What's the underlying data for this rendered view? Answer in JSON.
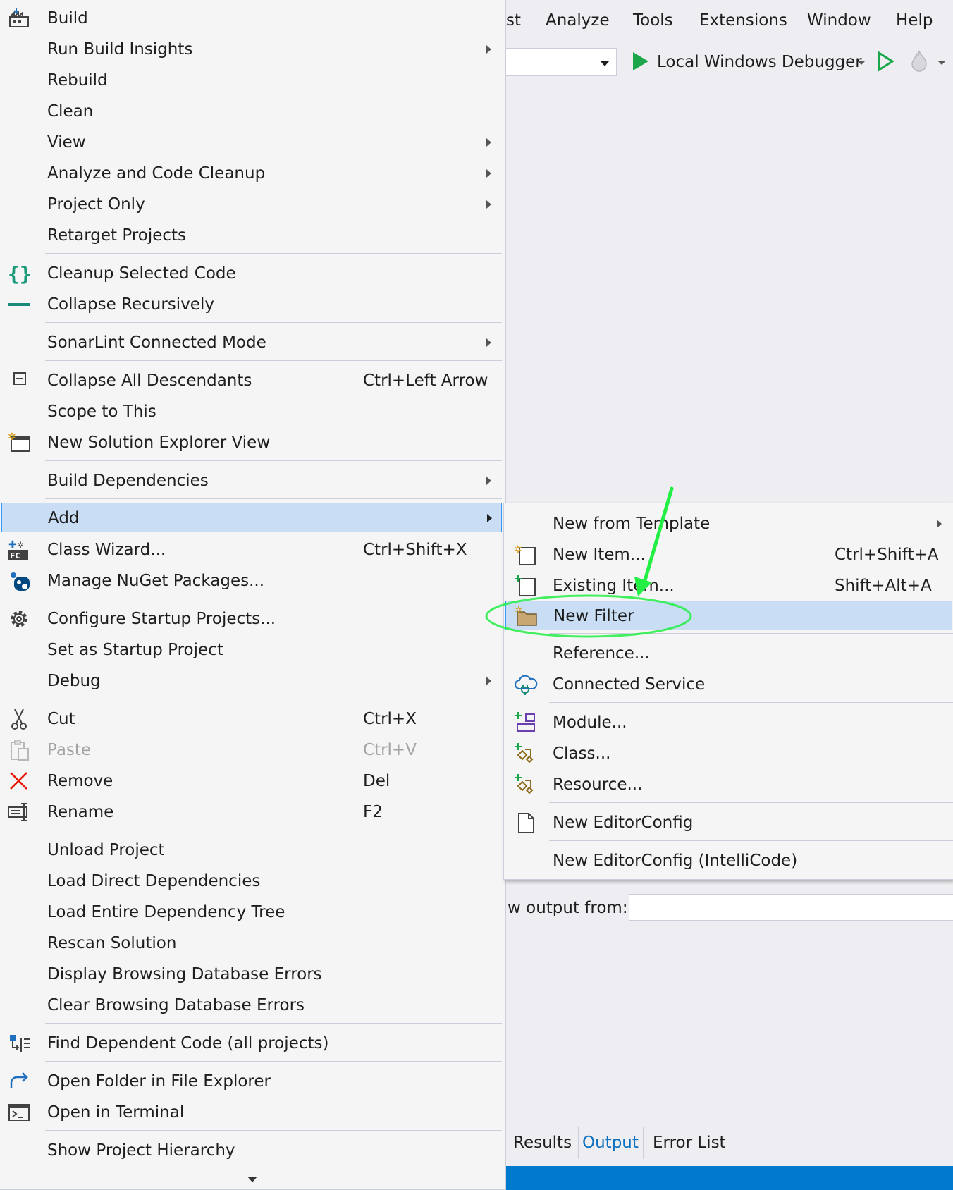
{
  "menubar": [
    "st",
    "Analyze",
    "Tools",
    "Extensions",
    "Window",
    "Help"
  ],
  "toolbar": {
    "debugger_label": "Local Windows Debugger"
  },
  "main_menu": {
    "items": [
      {
        "label": "Build",
        "icon": "build-icon"
      },
      {
        "label": "Run Build Insights",
        "submenu": true
      },
      {
        "label": "Rebuild"
      },
      {
        "label": "Clean"
      },
      {
        "label": "View",
        "submenu": true
      },
      {
        "label": "Analyze and Code Cleanup",
        "submenu": true
      },
      {
        "label": "Project Only",
        "submenu": true
      },
      {
        "label": "Retarget Projects"
      },
      {
        "label": "Cleanup Selected Code",
        "icon": "braces-icon"
      },
      {
        "label": "Collapse Recursively",
        "icon": "minus-icon"
      },
      {
        "label": "SonarLint Connected Mode",
        "submenu": true
      },
      {
        "label": "Collapse All Descendants",
        "shortcut": "Ctrl+Left Arrow",
        "icon": "collapse-icon"
      },
      {
        "label": "Scope to This"
      },
      {
        "label": "New Solution Explorer View",
        "icon": "new-window-icon"
      },
      {
        "label": "Build Dependencies",
        "submenu": true
      },
      {
        "label": "Add",
        "submenu": true,
        "highlighted": true
      },
      {
        "label": "Class Wizard...",
        "shortcut": "Ctrl+Shift+X",
        "icon": "class-wizard-icon"
      },
      {
        "label": "Manage NuGet Packages...",
        "icon": "nuget-icon"
      },
      {
        "label": "Configure Startup Projects...",
        "icon": "gear-icon"
      },
      {
        "label": "Set as Startup Project"
      },
      {
        "label": "Debug",
        "submenu": true
      },
      {
        "label": "Cut",
        "shortcut": "Ctrl+X",
        "icon": "scissors-icon"
      },
      {
        "label": "Paste",
        "shortcut": "Ctrl+V",
        "icon": "paste-icon",
        "disabled": true
      },
      {
        "label": "Remove",
        "shortcut": "Del",
        "icon": "remove-x-icon"
      },
      {
        "label": "Rename",
        "shortcut": "F2",
        "icon": "rename-icon"
      },
      {
        "label": "Unload Project"
      },
      {
        "label": "Load Direct Dependencies"
      },
      {
        "label": "Load Entire Dependency Tree"
      },
      {
        "label": "Rescan Solution"
      },
      {
        "label": "Display Browsing Database Errors"
      },
      {
        "label": "Clear Browsing Database Errors"
      },
      {
        "label": "Find Dependent Code (all projects)",
        "icon": "dependent-code-icon"
      },
      {
        "label": "Open Folder in File Explorer",
        "icon": "redo-arrow-icon"
      },
      {
        "label": "Open in Terminal",
        "icon": "terminal-icon"
      },
      {
        "label": "Show Project Hierarchy"
      }
    ]
  },
  "sub_menu": {
    "items": [
      {
        "label": "New from Template",
        "submenu": true
      },
      {
        "label": "New Item...",
        "shortcut": "Ctrl+Shift+A",
        "icon": "new-item-icon"
      },
      {
        "label": "Existing Item...",
        "shortcut": "Shift+Alt+A",
        "icon": "existing-item-icon"
      },
      {
        "label": "New Filter",
        "highlighted": true,
        "icon": "new-folder-icon"
      },
      {
        "label": "Reference..."
      },
      {
        "label": "Connected Service",
        "icon": "cloud-plug-icon"
      },
      {
        "label": "Module...",
        "icon": "module-icon"
      },
      {
        "label": "Class...",
        "icon": "class-add-icon"
      },
      {
        "label": "Resource...",
        "icon": "resource-add-icon"
      },
      {
        "label": "New EditorConfig",
        "icon": "document-icon"
      },
      {
        "label": "New EditorConfig (IntelliCode)"
      }
    ]
  },
  "output_panel": {
    "label": "w output from:"
  },
  "tabs": [
    "Results",
    "Output",
    "Error List"
  ],
  "colors": {
    "menu_bg": "#f5f5f5",
    "highlight_bg": "#c9def5",
    "highlight_border": "#3399ff",
    "annotation_green": "#22ee44",
    "statusbar": "#007acc",
    "run_green": "#1ca64a"
  }
}
